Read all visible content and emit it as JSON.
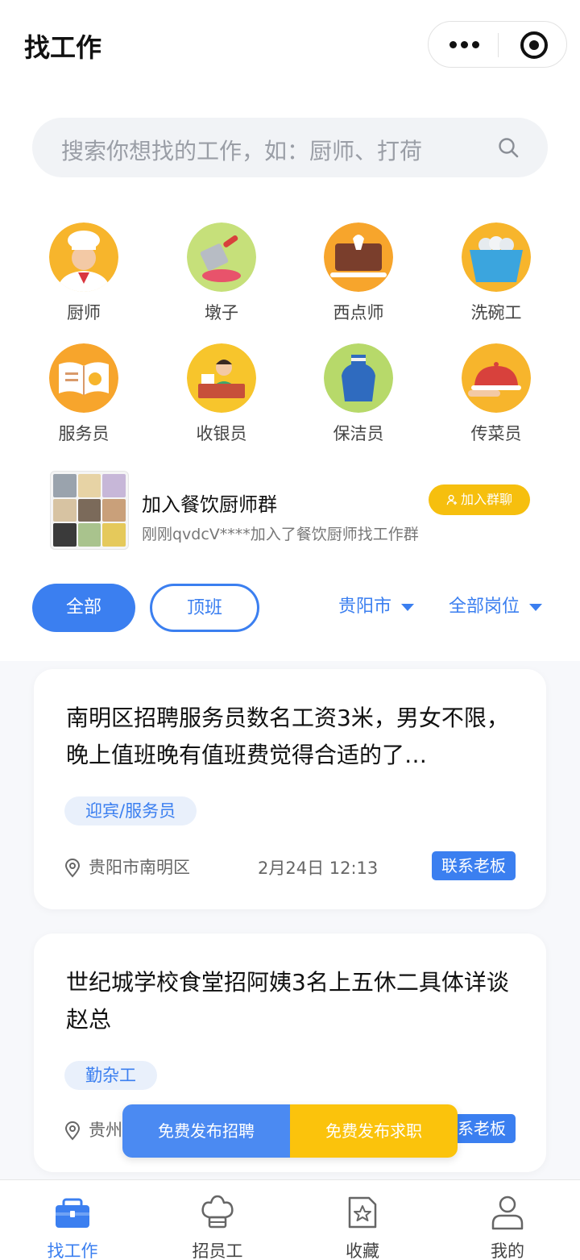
{
  "header": {
    "title": "找工作"
  },
  "search": {
    "placeholder": "搜索你想找的工作，如：厨师、打荷"
  },
  "categories": [
    {
      "label": "厨师",
      "icon": "chef-icon"
    },
    {
      "label": "墩子",
      "icon": "cleaver-icon"
    },
    {
      "label": "西点师",
      "icon": "pastry-icon"
    },
    {
      "label": "洗碗工",
      "icon": "dish-basin-icon"
    },
    {
      "label": "服务员",
      "icon": "menu-book-icon"
    },
    {
      "label": "收银员",
      "icon": "cashier-icon"
    },
    {
      "label": "保洁员",
      "icon": "apron-icon"
    },
    {
      "label": "传菜员",
      "icon": "cloche-icon"
    }
  ],
  "group": {
    "name": "加入餐饮厨师群",
    "subtitle": "刚刚qvdcV****加入了餐饮厨师找工作群",
    "join_label": "加入群聊"
  },
  "filters": {
    "all": "全部",
    "top": "顶班",
    "city": "贵阳市",
    "position": "全部岗位"
  },
  "jobs": [
    {
      "title": "南明区招聘服务员数名工资3米，男女不限，晚上值班晚有值班费觉得合适的了…",
      "tag": "迎宾/服务员",
      "location": "贵阳市南明区",
      "time": "2月24日 12:13",
      "contact": "联系老板"
    },
    {
      "title": "世纪城学校食堂招阿姨3名上五休二具体详谈赵总",
      "tag": "勤杂工",
      "location": "贵州",
      "contact": "联系老板"
    }
  ],
  "actions": {
    "post_job": "免费发布招聘",
    "post_resume": "免费发布求职"
  },
  "tabbar": [
    {
      "label": "找工作",
      "icon": "briefcase-icon",
      "active": true
    },
    {
      "label": "招员工",
      "icon": "chef-hat-icon",
      "active": false
    },
    {
      "label": "收藏",
      "icon": "star-doc-icon",
      "active": false
    },
    {
      "label": "我的",
      "icon": "user-icon",
      "active": false
    }
  ],
  "colors": {
    "accent": "#3b7ff0",
    "yellow": "#fbc30c"
  }
}
